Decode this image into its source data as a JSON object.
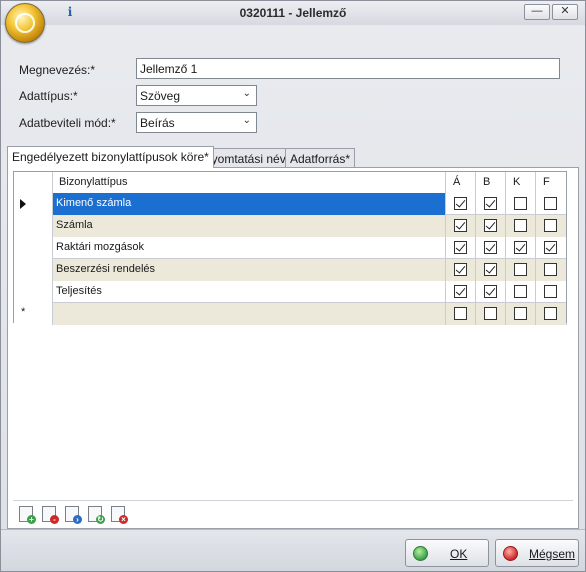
{
  "window": {
    "title": "0320111 - Jellemző",
    "minimize_label": "—",
    "close_label": "✕",
    "info_label": "i"
  },
  "form": {
    "name_label": "Megnevezés:*",
    "name_value": "Jellemző 1",
    "type_label": "Adattípus:*",
    "type_value": "Szöveg",
    "entry_label": "Adatbeviteli mód:*",
    "entry_value": "Beírás"
  },
  "tabs": [
    {
      "label": "Engedélyezett bizonylattípusok köre*",
      "active": true
    },
    {
      "label": "Nyomtatási név",
      "active": false
    },
    {
      "label": "Adatforrás*",
      "active": false
    }
  ],
  "grid": {
    "columns": {
      "type": "Bizonylattípus",
      "a": "Á",
      "b": "B",
      "k": "K",
      "f": "F"
    },
    "rows": [
      {
        "label": "Kimenő számla",
        "a": true,
        "b": true,
        "k": false,
        "f": false
      },
      {
        "label": "Számla",
        "a": true,
        "b": true,
        "k": false,
        "f": false
      },
      {
        "label": "Raktári mozgások",
        "a": true,
        "b": true,
        "k": true,
        "f": true
      },
      {
        "label": "Beszerzési rendelés",
        "a": true,
        "b": true,
        "k": false,
        "f": false
      },
      {
        "label": "Teljesítés",
        "a": true,
        "b": true,
        "k": false,
        "f": false
      }
    ],
    "new_row_marker": "*"
  },
  "toolbar": {
    "icons": [
      "add-icon",
      "delete-icon",
      "export-icon",
      "refresh-icon",
      "clear-icon"
    ]
  },
  "footer": {
    "ok_label": "OK",
    "cancel_label": "Mégsem"
  },
  "colors": {
    "selected_row": "#1a6fd0",
    "alt_row": "#ece9da",
    "ok_icon": "#3aa14a",
    "cancel_icon": "#cc2a2a"
  }
}
